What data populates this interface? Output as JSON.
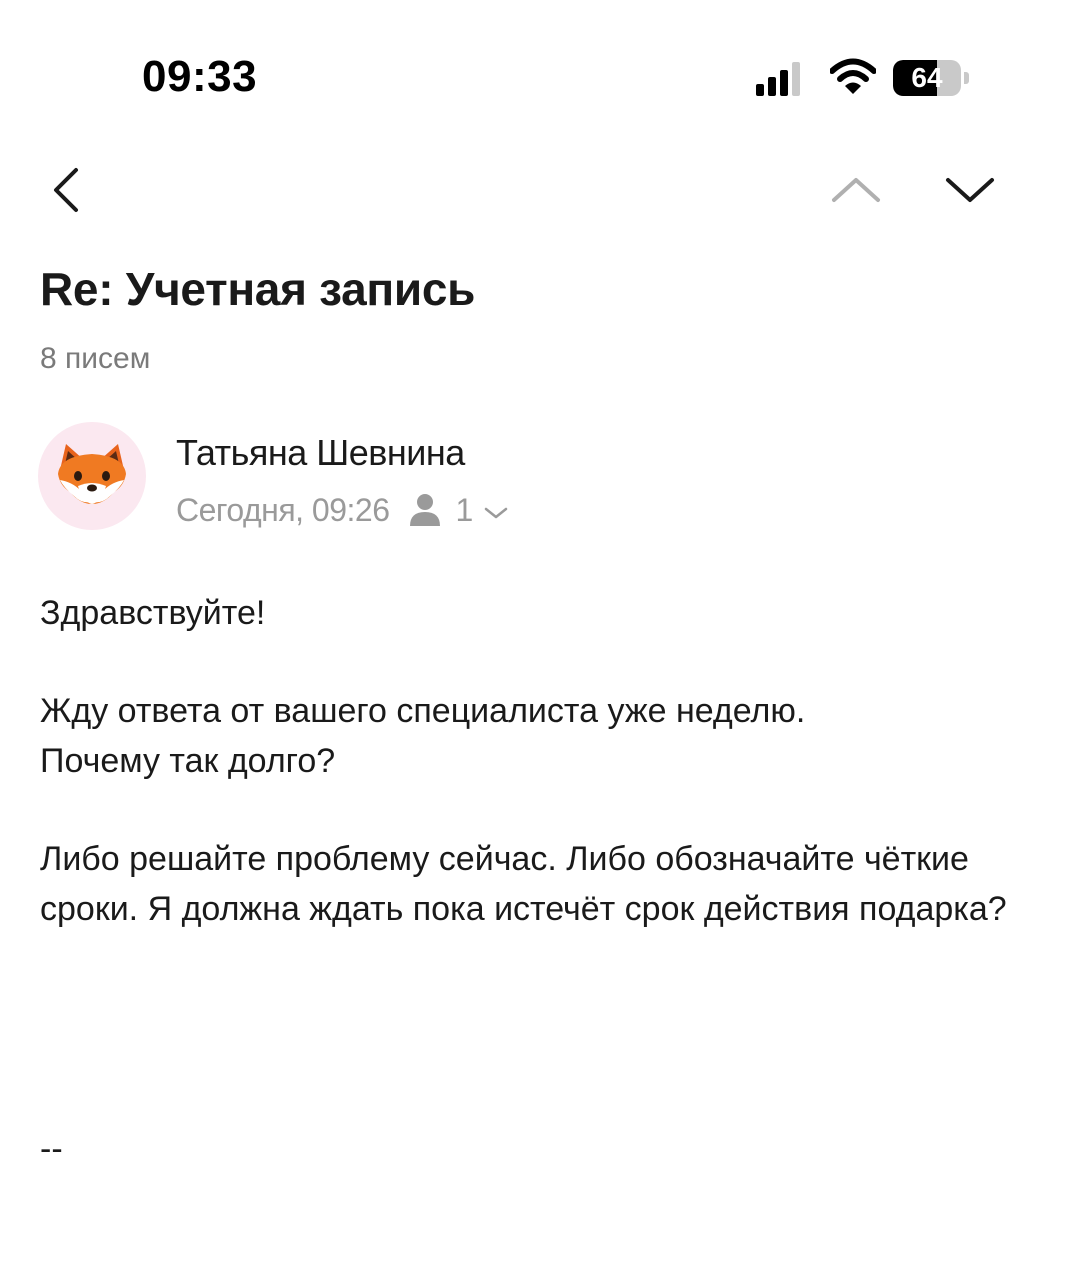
{
  "status_bar": {
    "time": "09:33",
    "battery_level": "64",
    "battery_fraction": 0.64,
    "signal_icon": "cellular-signal-icon",
    "wifi_icon": "wifi-icon"
  },
  "nav": {
    "back_icon": "chevron-left-icon",
    "prev_icon": "chevron-up-icon",
    "next_icon": "chevron-down-icon"
  },
  "thread": {
    "subject": "Re: Учетная запись",
    "count": "8 писем"
  },
  "message": {
    "sender": "Татьяна Шевнина",
    "avatar_icon": "fox-emoji-avatar",
    "avatar_emoji": "🦊",
    "date": "Сегодня, 09:26",
    "recipient_count": "1",
    "paragraphs": [
      "Здравствуйте!",
      "Жду ответа от вашего специалиста уже неделю.\nПочему так долго?",
      "Либо решайте проблему сейчас. Либо обозначайте чёткие сроки. Я должна ждать пока истечёт срок действия подарка?"
    ],
    "signature": "--"
  },
  "colors": {
    "text": "#1a1a1a",
    "secondary_text": "#9a9a9a",
    "avatar_bg": "#fbe8f0"
  }
}
